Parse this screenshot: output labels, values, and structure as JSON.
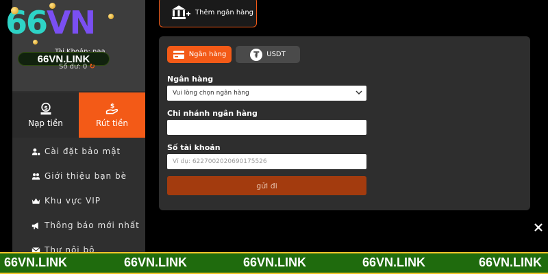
{
  "brand": {
    "logo_text_a": "66",
    "logo_text_b": "VN",
    "link_badge": "66VN.LINK"
  },
  "profile": {
    "account_label": "Tài Khoản: naa",
    "balance_label": "Số dư: 0",
    "refresh_glyph": "↻"
  },
  "actions": {
    "deposit": "Nạp tiền",
    "withdraw": "Rút tiền"
  },
  "menu": [
    {
      "label": "Cài đặt bảo mật",
      "icon": "user-lock-icon"
    },
    {
      "label": "Giới thiệu bạn bè",
      "icon": "friends-icon"
    },
    {
      "label": "Khu vực VIP",
      "icon": "vip-crown-icon"
    },
    {
      "label": "Thông báo mới nhất",
      "icon": "megaphone-icon"
    },
    {
      "label": "Thư nội bộ",
      "icon": "mail-icon"
    }
  ],
  "add_bank": {
    "label": "Thêm ngân hàng"
  },
  "tabs": {
    "bank": "Ngân hàng",
    "usdt": "USDT",
    "usdt_symbol": "₮"
  },
  "form": {
    "bank_label": "Ngân hàng",
    "bank_select_value": "Vui lòng chọn ngân hàng",
    "branch_label": "Chi nhánh ngân hàng",
    "branch_value": "",
    "account_label": "Số tài khoản",
    "account_placeholder": "Ví dụ: 6227002020690175526",
    "submit_label": "gửi đi"
  },
  "banner": {
    "items": [
      "66VN.LINK",
      "66VN.LINK",
      "66VN.LINK",
      "66VN.LINK",
      "66VN.LINK"
    ]
  },
  "colors": {
    "accent": "#f35a17",
    "panel": "#2e2e2e",
    "sidebar": "#2f2f2f",
    "banner_green": "#1f6b0d",
    "banner_border": "#f2c62b"
  }
}
